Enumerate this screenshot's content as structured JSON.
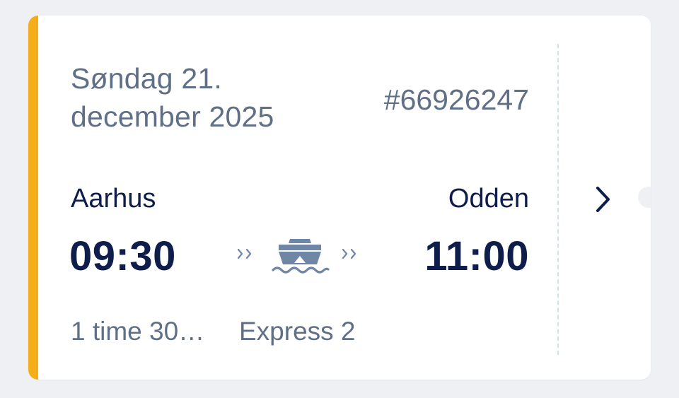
{
  "ticket": {
    "date": "Søndag 21. december 2025",
    "booking_number": "#66926247",
    "departure": {
      "city": "Aarhus",
      "time": "09:30"
    },
    "arrival": {
      "city": "Odden",
      "time": "11:00"
    },
    "duration": "1 time 30…",
    "vessel": "Express 2",
    "icons": {
      "transport": "ferry-icon",
      "route": "double-chevron-right-icon",
      "open": "chevron-right-icon"
    }
  },
  "colors": {
    "accent": "#f5ad1a",
    "primary_text": "#0f1d4b",
    "secondary_text": "#5f6f85",
    "icon": "#6f86a6",
    "background": "#eef0f4",
    "divider": "#cfe2ee"
  }
}
